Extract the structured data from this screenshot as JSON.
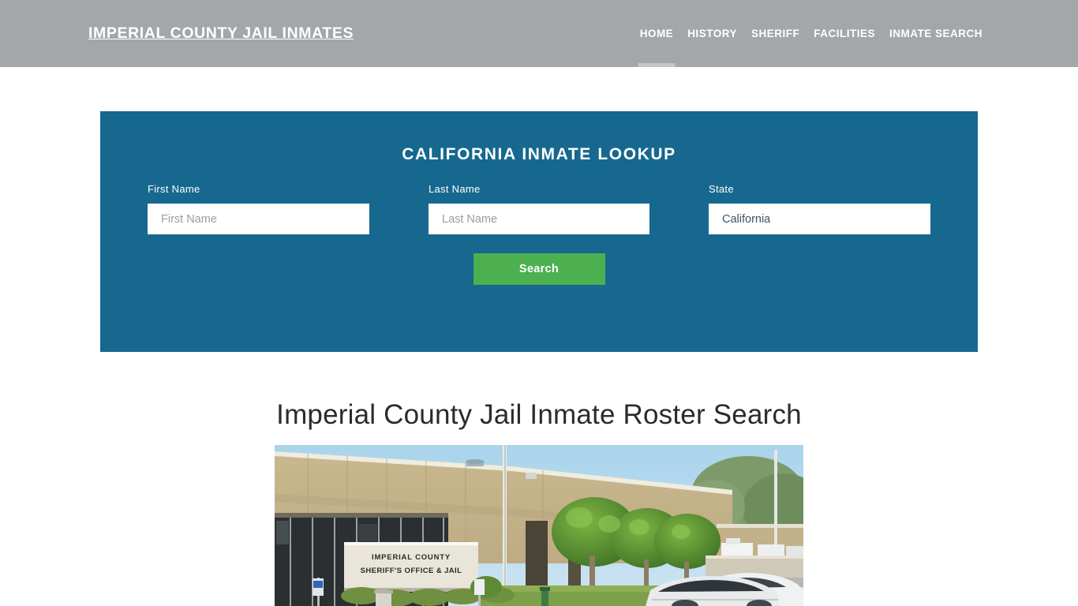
{
  "header": {
    "brand": "IMPERIAL COUNTY JAIL INMATES",
    "nav": [
      {
        "label": "HOME",
        "active": true
      },
      {
        "label": "HISTORY",
        "active": false
      },
      {
        "label": "SHERIFF",
        "active": false
      },
      {
        "label": "FACILITIES",
        "active": false
      },
      {
        "label": "INMATE SEARCH",
        "active": false
      }
    ],
    "background_color": "#a3a7aa",
    "text_color": "#ffffff"
  },
  "lookup": {
    "title": "CALIFORNIA INMATE LOOKUP",
    "panel_color": "#16688e",
    "first_name": {
      "label": "First Name",
      "placeholder": "First Name",
      "value": ""
    },
    "last_name": {
      "label": "Last Name",
      "placeholder": "Last Name",
      "value": ""
    },
    "state": {
      "label": "State",
      "selected": "California",
      "options": [
        "California"
      ]
    },
    "search_button": {
      "label": "Search",
      "color": "#4cb050"
    }
  },
  "main": {
    "heading": "Imperial County Jail Inmate Roster Search",
    "photo": {
      "alt": "Imperial County Sheriff's Office and Jail building exterior",
      "sign_line_1": "IMPERIAL COUNTY",
      "sign_line_2": "SHERIFF'S OFFICE & JAIL"
    }
  }
}
